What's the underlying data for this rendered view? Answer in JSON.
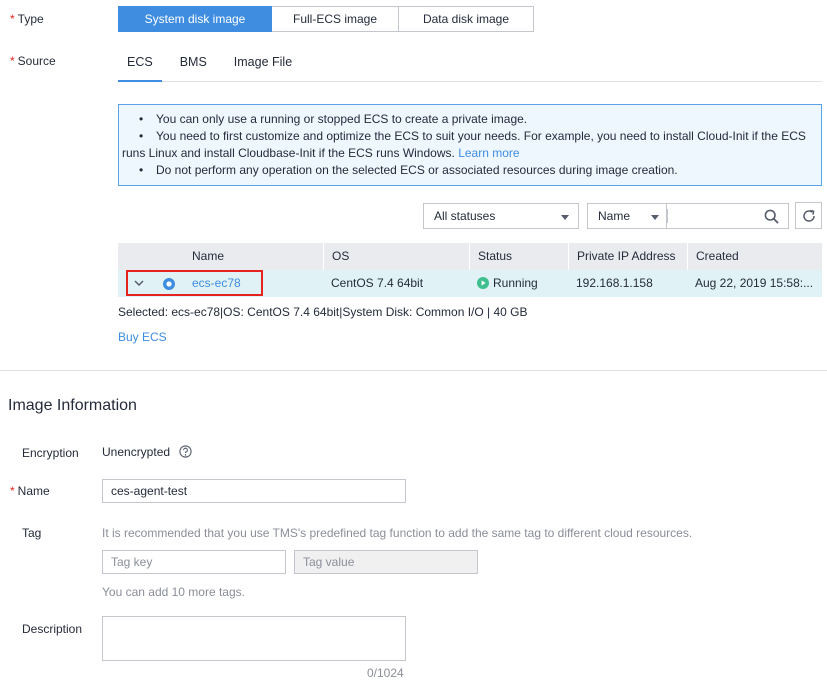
{
  "type": {
    "label": "Type",
    "options": [
      "System disk image",
      "Full-ECS image",
      "Data disk image"
    ],
    "selected": "System disk image"
  },
  "source": {
    "label": "Source",
    "tabs": [
      "ECS",
      "BMS",
      "Image File"
    ],
    "active_tab": "ECS"
  },
  "info": {
    "item1": "You can only use a running or stopped ECS to create a private image.",
    "item2_line1": "You need to first customize and optimize the ECS to suit your needs. For example, you need to install Cloud-Init if the ECS",
    "item2_line2": "runs Linux and install Cloudbase-Init if the ECS runs Windows.",
    "item2_link": "Learn more",
    "item3": "Do not perform any operation on the selected ECS or associated resources during image creation."
  },
  "filter": {
    "status_value": "All statuses",
    "search_field_value": "Name",
    "search_placeholder": ""
  },
  "table": {
    "columns": [
      "Name",
      "OS",
      "Status",
      "Private IP Address",
      "Created"
    ],
    "rows": [
      {
        "name": "ecs-ec78",
        "os": "CentOS 7.4 64bit",
        "status": "Running",
        "ip": "192.168.1.158",
        "created": "Aug 22, 2019 15:58:..."
      }
    ]
  },
  "selected_text": "Selected: ecs-ec78|OS: CentOS 7.4 64bit|System Disk: Common I/O | 40 GB",
  "buy_link": "Buy ECS",
  "image_info": {
    "heading": "Image Information",
    "encryption_label": "Encryption",
    "encryption_value": "Unencrypted",
    "name_label": "Name",
    "name_value": "ces-agent-test",
    "tag_label": "Tag",
    "tag_hint": "It is recommended that you use TMS's predefined tag function to add the same tag to different cloud resources.",
    "tag_key_placeholder": "Tag key",
    "tag_value_placeholder": "Tag value",
    "tag_count_hint": "You can add 10 more tags.",
    "description_label": "Description",
    "description_value": "",
    "description_counter": "0/1024"
  },
  "colors": {
    "accent": "#3f8de0",
    "required": "#e6231f",
    "running": "#3fbf8f",
    "highlight_border": "#e6231f",
    "selected_row": "#e0f2f5"
  }
}
